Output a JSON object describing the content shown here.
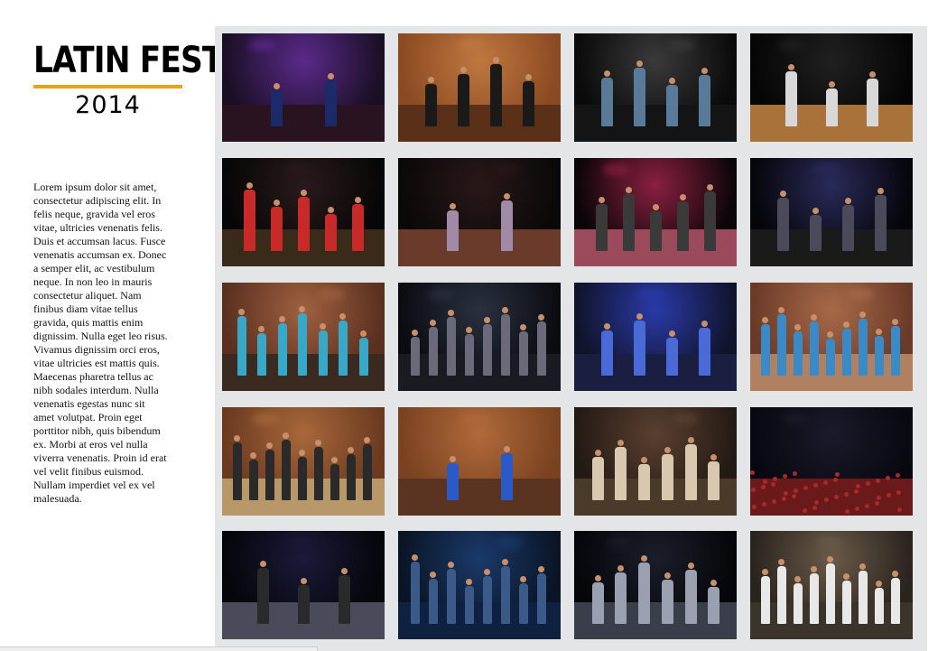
{
  "header": {
    "title": "LATIN FEST",
    "year": "2014",
    "accent_color": "#e8a31b"
  },
  "description": "Lorem ipsum dolor sit amet,\nconsectetur adipiscing elit. In\nfelis neque, gravida vel eros\nvitae, ultricies venenatis felis.\nDuis et accumsan lacus. Fusce\nvenenatis accumsan ex. Donec\na semper elit, ac vestibulum\nneque. In non leo in mauris\nconsectetur aliquet. Nam\nfinibus diam vitae tellus\ngravida, quis mattis enim\ndignissim. Nulla eget leo risus.\nVivamus dignissim orci eros,\nvitae ultricies est mattis quis.\nMaecenas pharetra tellus ac\nnibh sodales interdum. Nulla\nvenenatis egestas nunc sit\namet volutpat. Proin eget\nporttitor nibh, quis bibendum\nex. Morbi at eros vel nulla\nviverra venenatis. Proin id erat\nvel velit finibus euismod.\nNullam imperdiet vel ex vel\nmalesuada.",
  "gallery": {
    "background_color": "#e4e5e7",
    "photos": [
      {
        "scene": "dancing-couple",
        "bg": "#1a0f24",
        "glow": "#5a2a8a",
        "floor": "#2a1320",
        "figure": "#1c2a6a",
        "people": 2
      },
      {
        "scene": "group-portrait",
        "bg": "#8a4a22",
        "glow": "#c07840",
        "floor": "#5a3018",
        "figure": "#1a1a1a",
        "people": 4
      },
      {
        "scene": "stage-performers",
        "bg": "#0a0a0a",
        "glow": "#3a3a3a",
        "floor": "#141414",
        "figure": "#5a7a9a",
        "people": 4
      },
      {
        "scene": "dancers-on-stage",
        "bg": "#050505",
        "glow": "#202020",
        "floor": "#a8723a",
        "figure": "#d8d8d8",
        "people": 3
      },
      {
        "scene": "stage-dancers",
        "bg": "#060606",
        "glow": "#2a1a1a",
        "floor": "#3a2a1a",
        "figure": "#c82a2a",
        "people": 5
      },
      {
        "scene": "duo-dance",
        "bg": "#0a0808",
        "glow": "#2a1818",
        "floor": "#6a3a2a",
        "figure": "#a08aa8",
        "people": 2
      },
      {
        "scene": "band-stage",
        "bg": "#0a0508",
        "glow": "#8a2040",
        "floor": "#9a4a5a",
        "figure": "#3a3a3a",
        "people": 5
      },
      {
        "scene": "band-performing",
        "bg": "#05050a",
        "glow": "#2a2a5a",
        "floor": "#1a1a1a",
        "figure": "#4a4a5a",
        "people": 4
      },
      {
        "scene": "crowd-portrait",
        "bg": "#5a3020",
        "glow": "#a06040",
        "floor": "#3a2a20",
        "figure": "#38a8c8",
        "people": 7
      },
      {
        "scene": "dance-floor",
        "bg": "#0a0c10",
        "glow": "#2a3040",
        "floor": "#1a1a22",
        "figure": "#6a6a7a",
        "people": 8
      },
      {
        "scene": "blue-crowd",
        "bg": "#10142a",
        "glow": "#2a3aa8",
        "floor": "#1a1e40",
        "figure": "#4a6ad8",
        "people": 4
      },
      {
        "scene": "group-lineup",
        "bg": "#6a3a28",
        "glow": "#a86a48",
        "floor": "#b08060",
        "figure": "#3a8ac8",
        "people": 9
      },
      {
        "scene": "group-photo",
        "bg": "#6a3a20",
        "glow": "#a8683a",
        "floor": "#b89868",
        "figure": "#2a2a2a",
        "people": 9
      },
      {
        "scene": "two-friends",
        "bg": "#7a4220",
        "glow": "#b06a3a",
        "floor": "#5a3420",
        "figure": "#2a5ac8",
        "people": 2
      },
      {
        "scene": "friends-posing",
        "bg": "#241a14",
        "glow": "#5a4030",
        "floor": "#4a3a2a",
        "figure": "#d8c8b0",
        "people": 6
      },
      {
        "scene": "concert-crowd",
        "bg": "#080810",
        "glow": "#1a1a2a",
        "floor": "#6a1a1a",
        "figure": "#a82a2a",
        "people": 0
      },
      {
        "scene": "singer-stage",
        "bg": "#05050a",
        "glow": "#1a1a3a",
        "floor": "#4a4a5a",
        "figure": "#2a2a2a",
        "people": 3
      },
      {
        "scene": "blue-dance-floor",
        "bg": "#0a1424",
        "glow": "#1a3a6a",
        "floor": "#102040",
        "figure": "#3a5a8a",
        "people": 8
      },
      {
        "scene": "stage-show",
        "bg": "#05060a",
        "glow": "#1a1e2a",
        "floor": "#3a3e4a",
        "figure": "#9aa0b0",
        "people": 6
      },
      {
        "scene": "group-lineup-2",
        "bg": "#2a241e",
        "glow": "#6a5a48",
        "floor": "#3a342a",
        "figure": "#e8e8e8",
        "people": 9
      }
    ]
  }
}
